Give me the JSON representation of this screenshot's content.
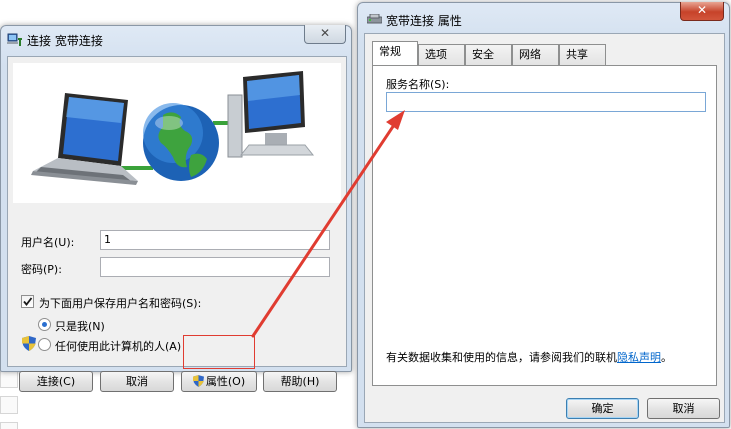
{
  "left_dialog": {
    "title": "连接 宽带连接",
    "close_symbol": "✕",
    "username_label": "用户名(U):",
    "username_value": "1",
    "password_label": "密码(P):",
    "password_value": "",
    "save_credentials_label": "为下面用户保存用户名和密码(S):",
    "save_credentials_checked": true,
    "only_me_label": "只是我(N)",
    "anyone_label": "任何使用此计算机的人(A)",
    "buttons": {
      "connect": "连接(C)",
      "cancel": "取消",
      "properties": "属性(O)",
      "help": "帮助(H)"
    }
  },
  "right_dialog": {
    "title": "宽带连接 属性",
    "close_symbol": "✕",
    "tabs": [
      "常规",
      "选项",
      "安全",
      "网络",
      "共享"
    ],
    "active_tab": "常规",
    "service_name_label": "服务名称(S):",
    "service_name_value": "",
    "info_text": "有关数据收集和使用的信息，请参阅我们的联机",
    "privacy_link": "隐私声明",
    "info_suffix": "。",
    "ok_button": "确定",
    "cancel_button": "取消"
  },
  "colors": {
    "annotation_red": "#e03c31",
    "link_blue": "#0066cc"
  },
  "icons": [
    "network-connection-icon",
    "laptop-icon",
    "globe-icon",
    "desktop-computer-icon",
    "uac-shield-icon",
    "modem-icon"
  ]
}
